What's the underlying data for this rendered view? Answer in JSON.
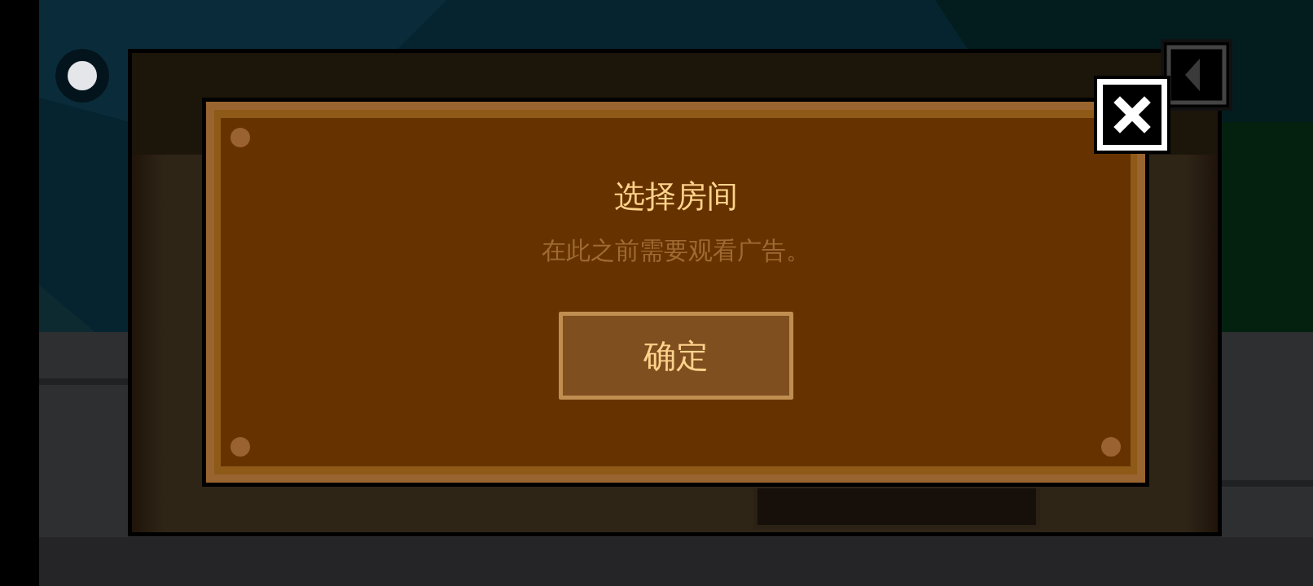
{
  "dialog": {
    "title": "选择房间",
    "message": "在此之前需要观看广告。",
    "confirm_button": "确定"
  }
}
